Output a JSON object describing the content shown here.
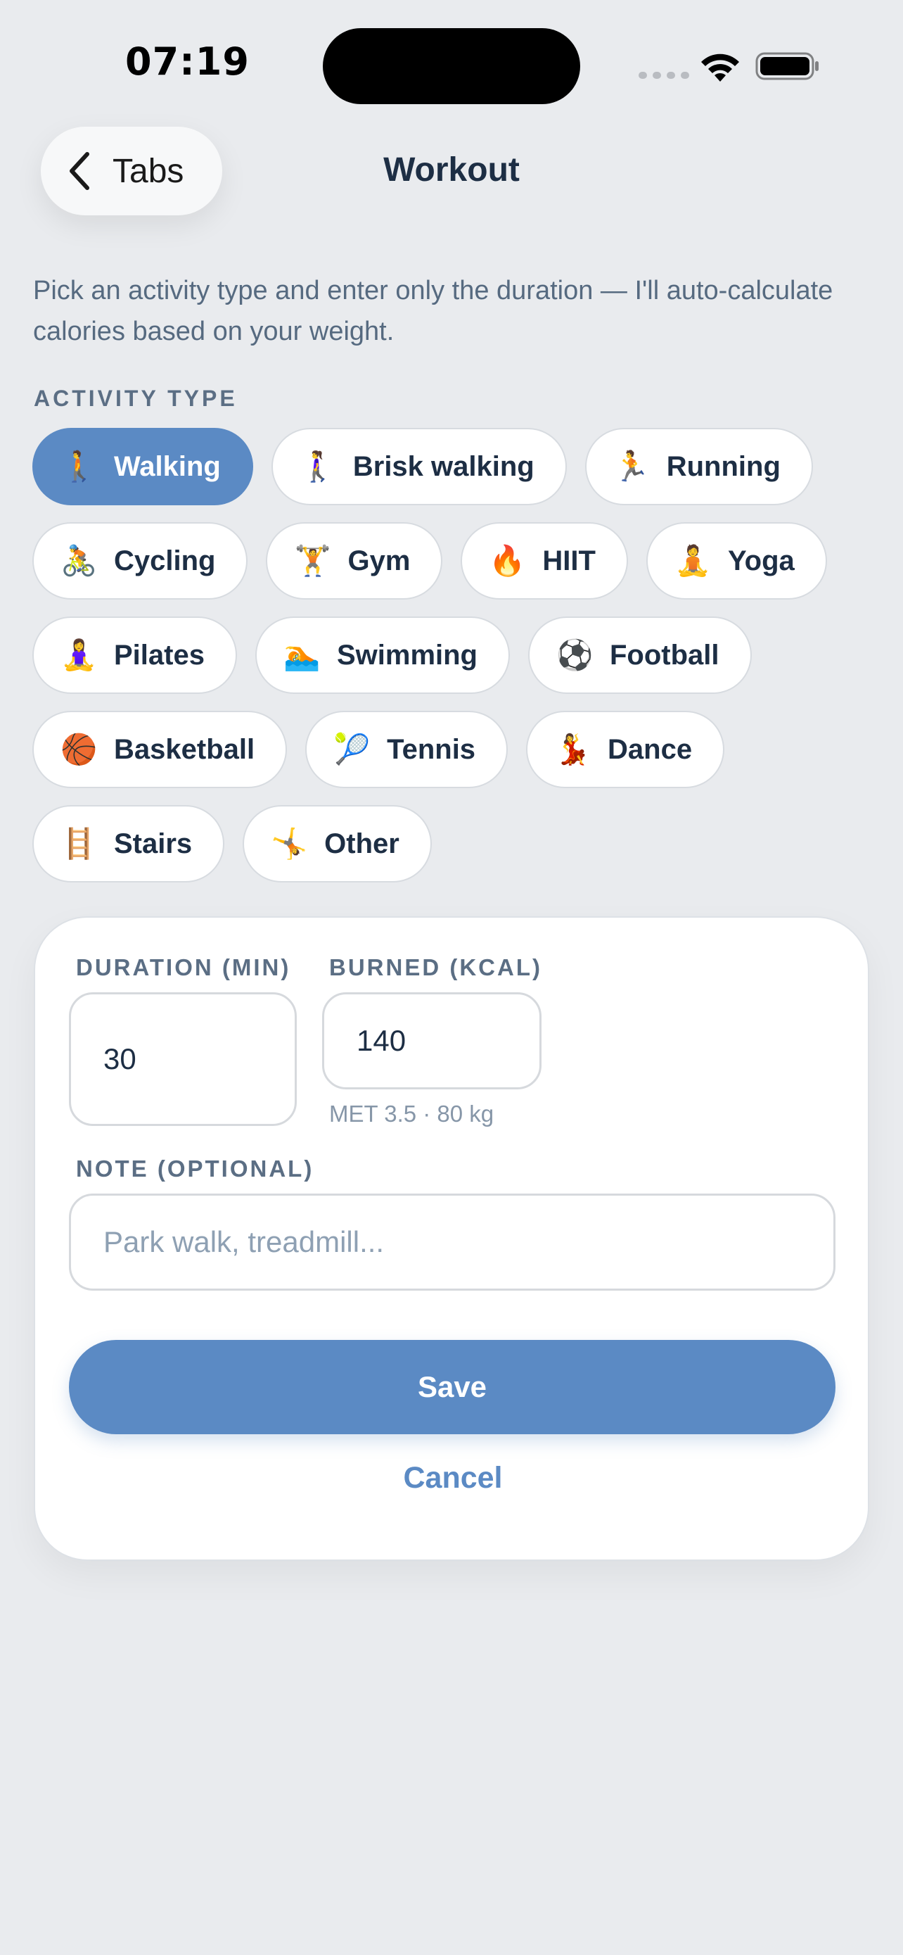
{
  "status_bar": {
    "time": "07:19"
  },
  "nav": {
    "back_label": "Tabs",
    "title": "Workout"
  },
  "intro": "Pick an activity type and enter only the duration — I'll auto-calculate calories based on your weight.",
  "activity_section": {
    "label": "ACTIVITY TYPE",
    "selected": "Walking",
    "rows": [
      [
        {
          "label": "Walking",
          "icon": "🚶",
          "icon_name": "person-walking-icon",
          "selected": true
        },
        {
          "label": "Brisk walking",
          "icon": "🚶‍♀️",
          "icon_name": "woman-walking-icon",
          "selected": false
        },
        {
          "label": "Running",
          "icon": "🏃",
          "icon_name": "person-running-icon",
          "selected": false
        }
      ],
      [
        {
          "label": "Cycling",
          "icon": "🚴",
          "icon_name": "person-biking-icon",
          "selected": false
        },
        {
          "label": "Gym",
          "icon": "🏋️",
          "icon_name": "weight-lifting-icon",
          "selected": false
        },
        {
          "label": "HIIT",
          "icon": "🔥",
          "icon_name": "fire-icon",
          "selected": false
        },
        {
          "label": "Yoga",
          "icon": "🧘",
          "icon_name": "lotus-position-icon",
          "selected": false
        }
      ],
      [
        {
          "label": "Pilates",
          "icon": "🧘‍♀️",
          "icon_name": "woman-lotus-position-icon",
          "selected": false
        },
        {
          "label": "Swimming",
          "icon": "🏊",
          "icon_name": "person-swimming-icon",
          "selected": false
        },
        {
          "label": "Football",
          "icon": "⚽",
          "icon_name": "soccer-ball-icon",
          "selected": false
        }
      ],
      [
        {
          "label": "Basketball",
          "icon": "🏀",
          "icon_name": "basketball-icon",
          "selected": false
        },
        {
          "label": "Tennis",
          "icon": "🎾",
          "icon_name": "tennis-ball-icon",
          "selected": false
        },
        {
          "label": "Dance",
          "icon": "💃",
          "icon_name": "woman-dancing-icon",
          "selected": false
        }
      ],
      [
        {
          "label": "Stairs",
          "icon": "🪜",
          "icon_name": "ladder-icon",
          "selected": false
        },
        {
          "label": "Other",
          "icon": "🤸",
          "icon_name": "cartwheel-icon",
          "selected": false
        }
      ]
    ]
  },
  "form": {
    "duration_label": "DURATION (MIN)",
    "duration_value": "30",
    "burned_label": "BURNED (KCAL)",
    "burned_value": "140",
    "met_note": "MET 3.5 · 80 kg",
    "note_label": "NOTE (OPTIONAL)",
    "note_placeholder": "Park walk, treadmill...",
    "save_label": "Save",
    "cancel_label": "Cancel"
  },
  "colors": {
    "accent": "#5b8ac4",
    "background": "#e9ebee",
    "title_text": "#1d2e44",
    "muted_text": "#5b6e84"
  }
}
